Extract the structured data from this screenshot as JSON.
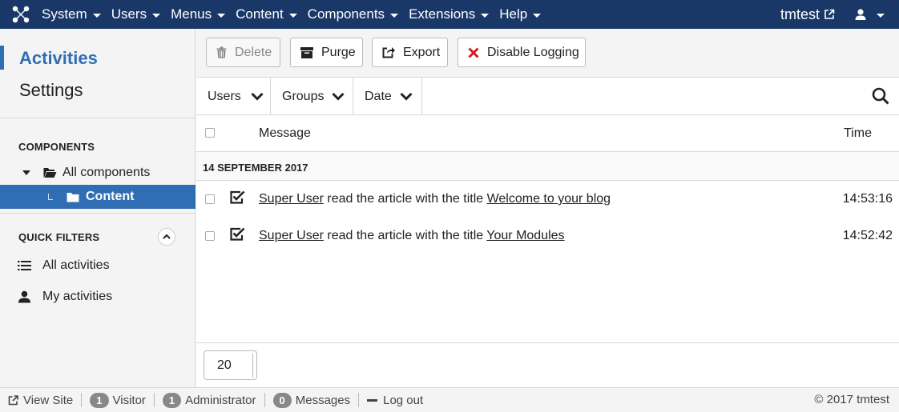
{
  "navbar": {
    "menus": [
      "System",
      "Users",
      "Menus",
      "Content",
      "Components",
      "Extensions",
      "Help"
    ],
    "site_name": "tmtest"
  },
  "sidebar": {
    "links": [
      {
        "label": "Activities",
        "active": true
      },
      {
        "label": "Settings",
        "active": false
      }
    ],
    "components_title": "COMPONENTS",
    "tree": [
      {
        "label": "All components",
        "active": false
      },
      {
        "label": "Content",
        "active": true
      }
    ],
    "quick_filters_title": "QUICK FILTERS",
    "quick_filters": [
      {
        "label": "All activities",
        "icon": "list-icon"
      },
      {
        "label": "My activities",
        "icon": "user-icon"
      }
    ]
  },
  "toolbar": {
    "delete_label": "Delete",
    "purge_label": "Purge",
    "export_label": "Export",
    "disable_label": "Disable Logging"
  },
  "filters": [
    "Users",
    "Groups",
    "Date"
  ],
  "table": {
    "col_message": "Message",
    "col_time": "Time",
    "group_label": "14 SEPTEMBER 2017",
    "rows": [
      {
        "user": "Super User",
        "action": "read the article with the title",
        "title": "Welcome to your blog",
        "time": "14:53:16"
      },
      {
        "user": "Super User",
        "action": "read the article with the title",
        "title": "Your Modules",
        "time": "14:52:42"
      }
    ]
  },
  "pager": {
    "limit": "20"
  },
  "statusbar": {
    "view_site": "View Site",
    "visitor_count": "1",
    "visitor_label": "Visitor",
    "admin_count": "1",
    "admin_label": "Administrator",
    "messages_count": "0",
    "messages_label": "Messages",
    "logout": "Log out",
    "copyright": "© 2017 tmtest"
  },
  "colors": {
    "navbar": "#1a3867",
    "accent": "#2f6eb3",
    "danger": "#d11f1f"
  }
}
